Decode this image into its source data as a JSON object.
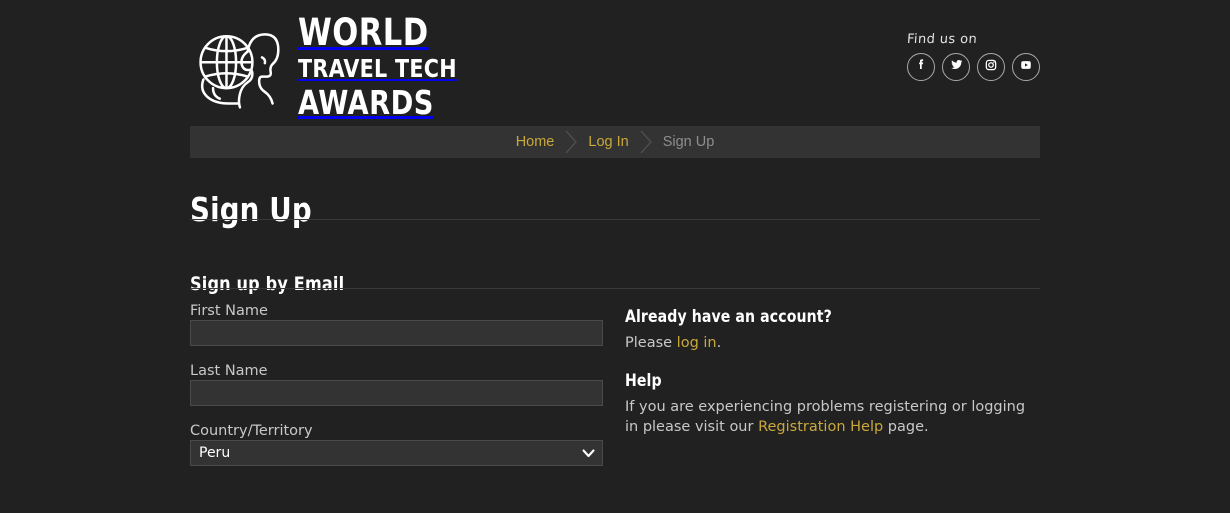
{
  "brand": {
    "logo_icon": "globe-head-logo",
    "line1": "WORLD",
    "line2": "TRAVEL TECH",
    "line3": "AWARDS"
  },
  "social": {
    "label": "Find us on",
    "items": [
      {
        "name": "facebook-icon",
        "title": "Facebook"
      },
      {
        "name": "twitter-icon",
        "title": "Twitter"
      },
      {
        "name": "instagram-icon",
        "title": "Instagram"
      },
      {
        "name": "youtube-icon",
        "title": "YouTube"
      }
    ]
  },
  "breadcrumb": {
    "items": [
      {
        "label": "Home",
        "current": false
      },
      {
        "label": "Log In",
        "current": false
      },
      {
        "label": "Sign Up",
        "current": true
      }
    ]
  },
  "page": {
    "title": "Sign Up",
    "section_title": "Sign up by Email"
  },
  "form": {
    "first_name": {
      "label": "First Name",
      "value": "",
      "placeholder": ""
    },
    "last_name": {
      "label": "Last Name",
      "value": "",
      "placeholder": ""
    },
    "country": {
      "label": "Country/Territory",
      "value": "Peru",
      "arrow_icon": "chevron-down-icon"
    }
  },
  "info": {
    "account_heading": "Already have an account?",
    "account_text_before": "Please ",
    "account_link": "log in",
    "account_text_after": ".",
    "help_heading": "Help",
    "help_text_before": "If you are experiencing problems registering or logging in please visit our ",
    "help_link": "Registration Help",
    "help_text_after": " page."
  },
  "colors": {
    "page_bg": "#212121",
    "bar_bg": "#333333",
    "accent_gold": "#c9a83c",
    "muted_text": "#8e8e8e",
    "body_text": "#c8c8c8",
    "field_bg": "#333333",
    "field_border": "#4a4a4a",
    "rule": "#3a3a3a"
  }
}
